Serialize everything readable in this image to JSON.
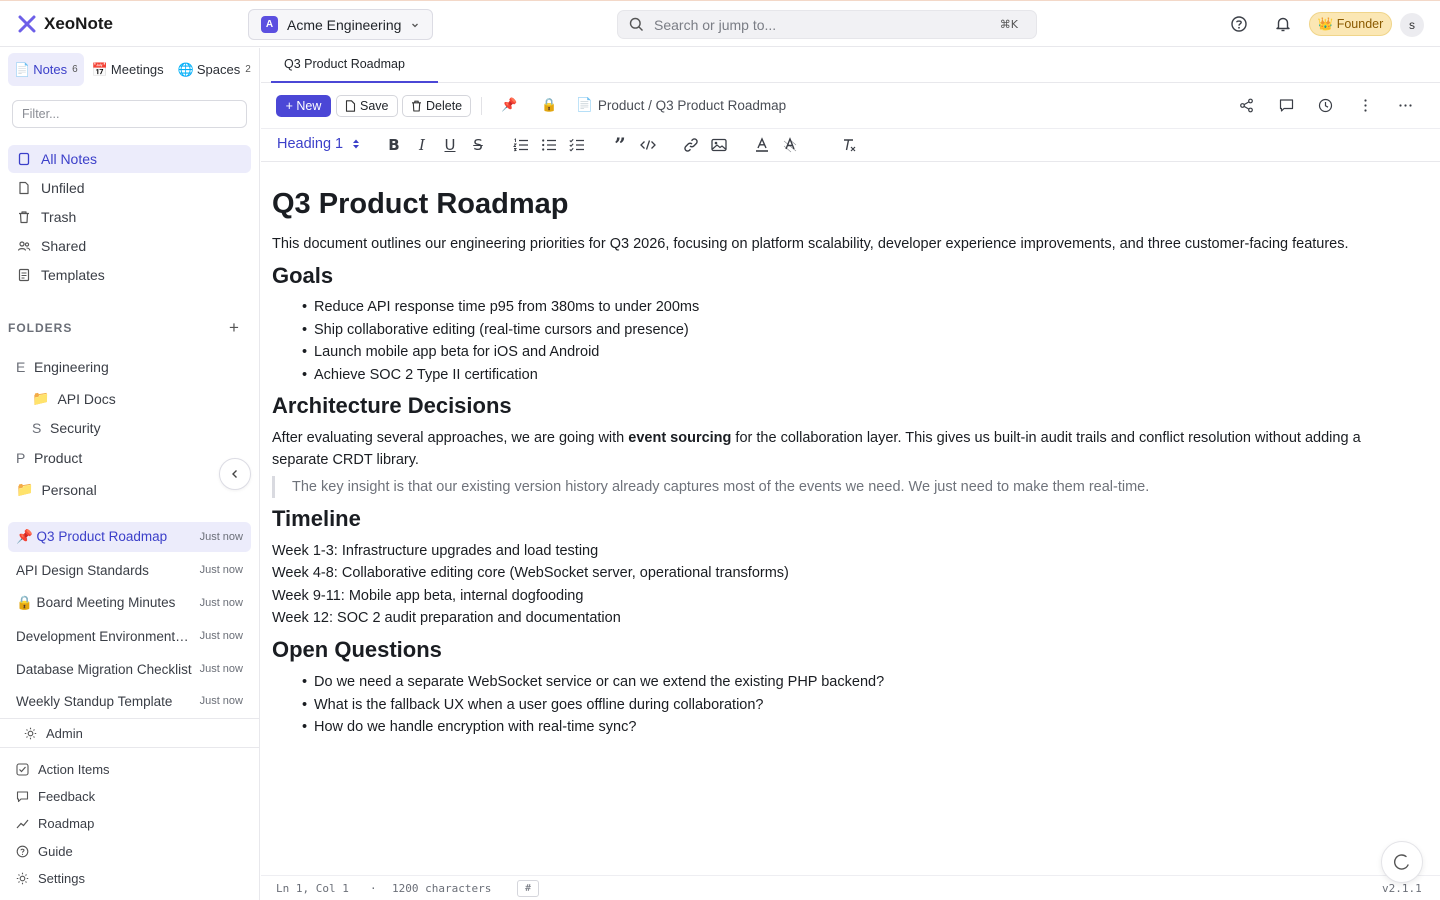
{
  "app": {
    "name": "XeoNote",
    "accent": "#4b47d6",
    "logo_icon": "x-logo-icon"
  },
  "workspace": {
    "initial": "A",
    "name": "Acme Engineering"
  },
  "search": {
    "placeholder": "Search or jump to...",
    "shortcut": "⌘K"
  },
  "header": {
    "badge": "👑 Founder",
    "user_initial": "s"
  },
  "sidebar": {
    "tabs": [
      {
        "icon": "📄",
        "label": "Notes",
        "count": "6"
      },
      {
        "icon": "📅",
        "label": "Meetings",
        "count": ""
      },
      {
        "icon": "🌐",
        "label": "Spaces",
        "count": "2"
      }
    ],
    "filter_placeholder": "Filter...",
    "nav": [
      {
        "label": "All Notes",
        "icon": "document-icon"
      },
      {
        "label": "Unfiled",
        "icon": "file-icon"
      },
      {
        "label": "Trash",
        "icon": "trash-icon"
      },
      {
        "label": "Shared",
        "icon": "people-icon"
      },
      {
        "label": "Templates",
        "icon": "template-icon"
      }
    ],
    "folders_heading": "FOLDERS",
    "folders_add": "+",
    "folders": [
      {
        "marker": "E",
        "label": "Engineering"
      },
      {
        "marker": "📁",
        "label": "API Docs"
      },
      {
        "marker": "S",
        "label": "Security"
      },
      {
        "marker": "P",
        "label": "Product"
      },
      {
        "marker": "📁",
        "label": "Personal"
      }
    ],
    "recent": [
      {
        "title": "📌 Q3 Product Roadmap",
        "time": "Just now"
      },
      {
        "title": "API Design Standards",
        "time": "Just now"
      },
      {
        "title": "🔒 Board Meeting Minutes",
        "time": "Just now"
      },
      {
        "title": "Development Environment Setup",
        "time": "Just now"
      },
      {
        "title": "Database Migration Checklist",
        "time": "Just now"
      },
      {
        "title": "Weekly Standup Template",
        "time": "Just now"
      }
    ],
    "admin": "Admin",
    "bottom": [
      "Action Items",
      "Feedback",
      "Roadmap",
      "Guide",
      "Settings"
    ]
  },
  "doc_tab": "Q3 Product Roadmap",
  "toolbar": {
    "new": "+ New",
    "save": "Save",
    "delete": "Delete",
    "pin": "📌",
    "lock": "🔒",
    "breadcrumb_icon": "📄",
    "breadcrumb": "Product / Q3 Product Roadmap",
    "heading_select": "Heading 1"
  },
  "document": {
    "title": "Q3 Product Roadmap",
    "intro": "This document outlines our engineering priorities for Q3 2026, focusing on platform scalability, developer experience improvements, and three customer-facing features.",
    "goals_heading": "Goals",
    "goals": [
      "Reduce API response time p95 from 380ms to under 200ms",
      "Ship collaborative editing (real-time cursors and presence)",
      "Launch mobile app beta for iOS and Android",
      "Achieve SOC 2 Type II certification"
    ],
    "arch_heading": "Architecture Decisions",
    "arch_p1_a": "After evaluating several approaches, we are going with ",
    "arch_p1_bold": "event sourcing",
    "arch_p1_b": " for the collaboration layer. This gives us built-in audit trails and conflict resolution without adding a",
    "arch_p1_c": "separate CRDT library.",
    "quote": "The key insight is that our existing version history already captures most of the events we need. We just need to make them real-time.",
    "timeline_heading": "Timeline",
    "timeline": [
      "Week 1-3: Infrastructure upgrades and load testing",
      "Week 4-8: Collaborative editing core (WebSocket server, operational transforms)",
      "Week 9-11: Mobile app beta, internal dogfooding",
      "Week 12: SOC 2 audit preparation and documentation"
    ],
    "questions_heading": "Open Questions",
    "questions": [
      "Do we need a separate WebSocket service or can we extend the existing PHP backend?",
      "What is the fallback UX when a user goes offline during collaboration?",
      "How do we handle encryption with real-time sync?"
    ]
  },
  "status": {
    "position": "Ln 1, Col 1",
    "dot": "·",
    "chars": "1200 characters",
    "hash": "#",
    "version": "v2.1.1"
  }
}
